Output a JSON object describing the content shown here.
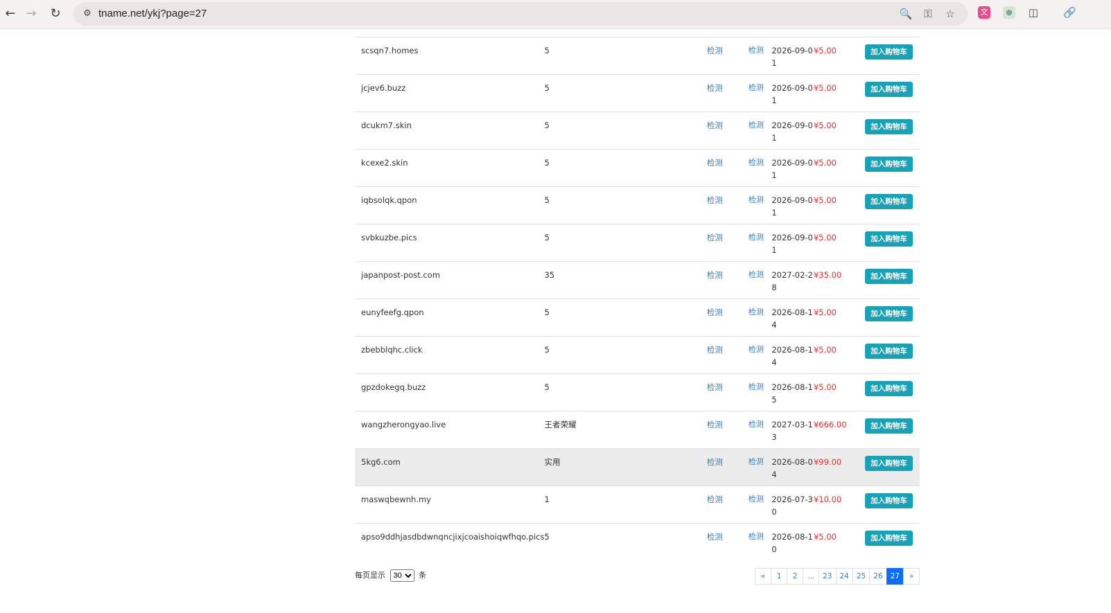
{
  "browser": {
    "url": "tname.net/ykj?page=27"
  },
  "table": {
    "rows": [
      {
        "domain": "scsqn7.homes",
        "note": "5",
        "check1": "检测",
        "check2": "检测",
        "date": "2026-09-01",
        "price": "¥5.00",
        "button": "加入购物车",
        "highlight": false
      },
      {
        "domain": "jcjev6.buzz",
        "note": "5",
        "check1": "检测",
        "check2": "检测",
        "date": "2026-09-01",
        "price": "¥5.00",
        "button": "加入购物车",
        "highlight": false
      },
      {
        "domain": "dcukm7.skin",
        "note": "5",
        "check1": "检测",
        "check2": "检测",
        "date": "2026-09-01",
        "price": "¥5.00",
        "button": "加入购物车",
        "highlight": false
      },
      {
        "domain": "kcexe2.skin",
        "note": "5",
        "check1": "检测",
        "check2": "检测",
        "date": "2026-09-01",
        "price": "¥5.00",
        "button": "加入购物车",
        "highlight": false
      },
      {
        "domain": "iqbsolqk.qpon",
        "note": "5",
        "check1": "检测",
        "check2": "检测",
        "date": "2026-09-01",
        "price": "¥5.00",
        "button": "加入购物车",
        "highlight": false
      },
      {
        "domain": "svbkuzbe.pics",
        "note": "5",
        "check1": "检测",
        "check2": "检测",
        "date": "2026-09-01",
        "price": "¥5.00",
        "button": "加入购物车",
        "highlight": false
      },
      {
        "domain": "japanpost-post.com",
        "note": "35",
        "check1": "检测",
        "check2": "检测",
        "date": "2027-02-28",
        "price": "¥35.00",
        "button": "加入购物车",
        "highlight": false
      },
      {
        "domain": "eunyfeefg.qpon",
        "note": "5",
        "check1": "检测",
        "check2": "检测",
        "date": "2026-08-14",
        "price": "¥5.00",
        "button": "加入购物车",
        "highlight": false
      },
      {
        "domain": "zbebblqhc.click",
        "note": "5",
        "check1": "检测",
        "check2": "检测",
        "date": "2026-08-14",
        "price": "¥5.00",
        "button": "加入购物车",
        "highlight": false
      },
      {
        "domain": "gpzdokegq.buzz",
        "note": "5",
        "check1": "检测",
        "check2": "检测",
        "date": "2026-08-15",
        "price": "¥5.00",
        "button": "加入购物车",
        "highlight": false
      },
      {
        "domain": "wangzherongyao.live",
        "note": "王者荣耀",
        "check1": "检测",
        "check2": "检测",
        "date": "2027-03-13",
        "price": "¥666.00",
        "button": "加入购物车",
        "highlight": false
      },
      {
        "domain": "5kg6.com",
        "note": "实用",
        "check1": "检测",
        "check2": "检测",
        "date": "2026-08-04",
        "price": "¥99.00",
        "button": "加入购物车",
        "highlight": true
      },
      {
        "domain": "maswqbewnh.my",
        "note": "1",
        "check1": "检测",
        "check2": "检测",
        "date": "2026-07-30",
        "price": "¥10.00",
        "button": "加入购物车",
        "highlight": false
      },
      {
        "domain": "apso9ddhjasdbdwnqncjixjcoaishoiqwfhqo.pics",
        "note": "5",
        "check1": "检测",
        "check2": "检测",
        "date": "2026-08-10",
        "price": "¥5.00",
        "button": "加入购物车",
        "highlight": false
      }
    ]
  },
  "footer": {
    "per_page_prefix": "每页显示",
    "per_page_value": "30",
    "per_page_suffix": "条",
    "pages": [
      "«",
      "1",
      "2",
      "...",
      "23",
      "24",
      "25",
      "26",
      "27",
      "»"
    ],
    "active_page": "27"
  },
  "colors": {
    "button": "#17a2b8",
    "price": "#e0302f",
    "link": "#3a7fb5",
    "active_page": "#0d6efd"
  }
}
